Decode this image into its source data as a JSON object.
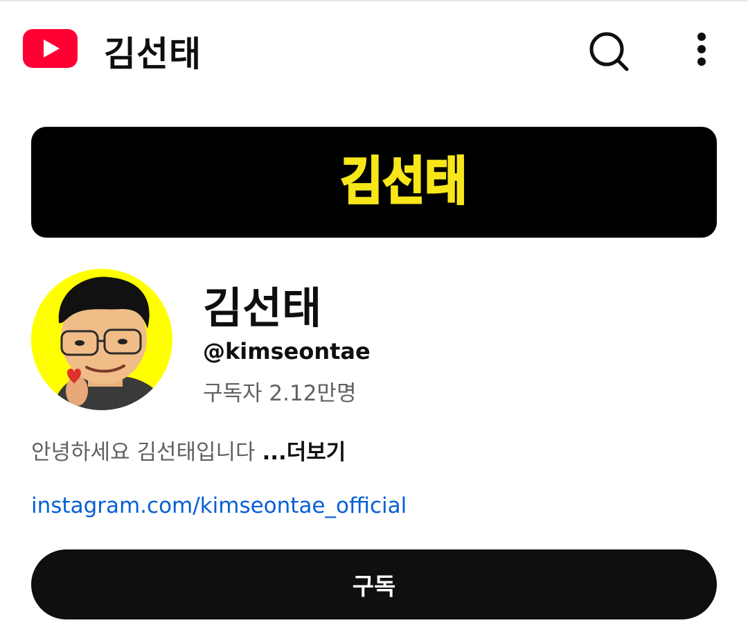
{
  "app": {
    "title": "김선태",
    "logo_icon": "youtube-logo-icon",
    "search_icon": "search-icon",
    "more_icon": "more-vertical-icon",
    "brand_color": "#ff0033"
  },
  "banner": {
    "logo_text": "김선태",
    "logo_color": "#f6e61a",
    "background": "#000000"
  },
  "channel": {
    "name": "김선태",
    "handle": "@kimseontae",
    "subscribers": "구독자 2.12만명",
    "description": "안녕하세요 김선태입니다 ",
    "more_label": "...더보기",
    "link": "instagram.com/kimseontae_official",
    "avatar_background": "#ffff00"
  },
  "actions": {
    "subscribe_label": "구독"
  }
}
